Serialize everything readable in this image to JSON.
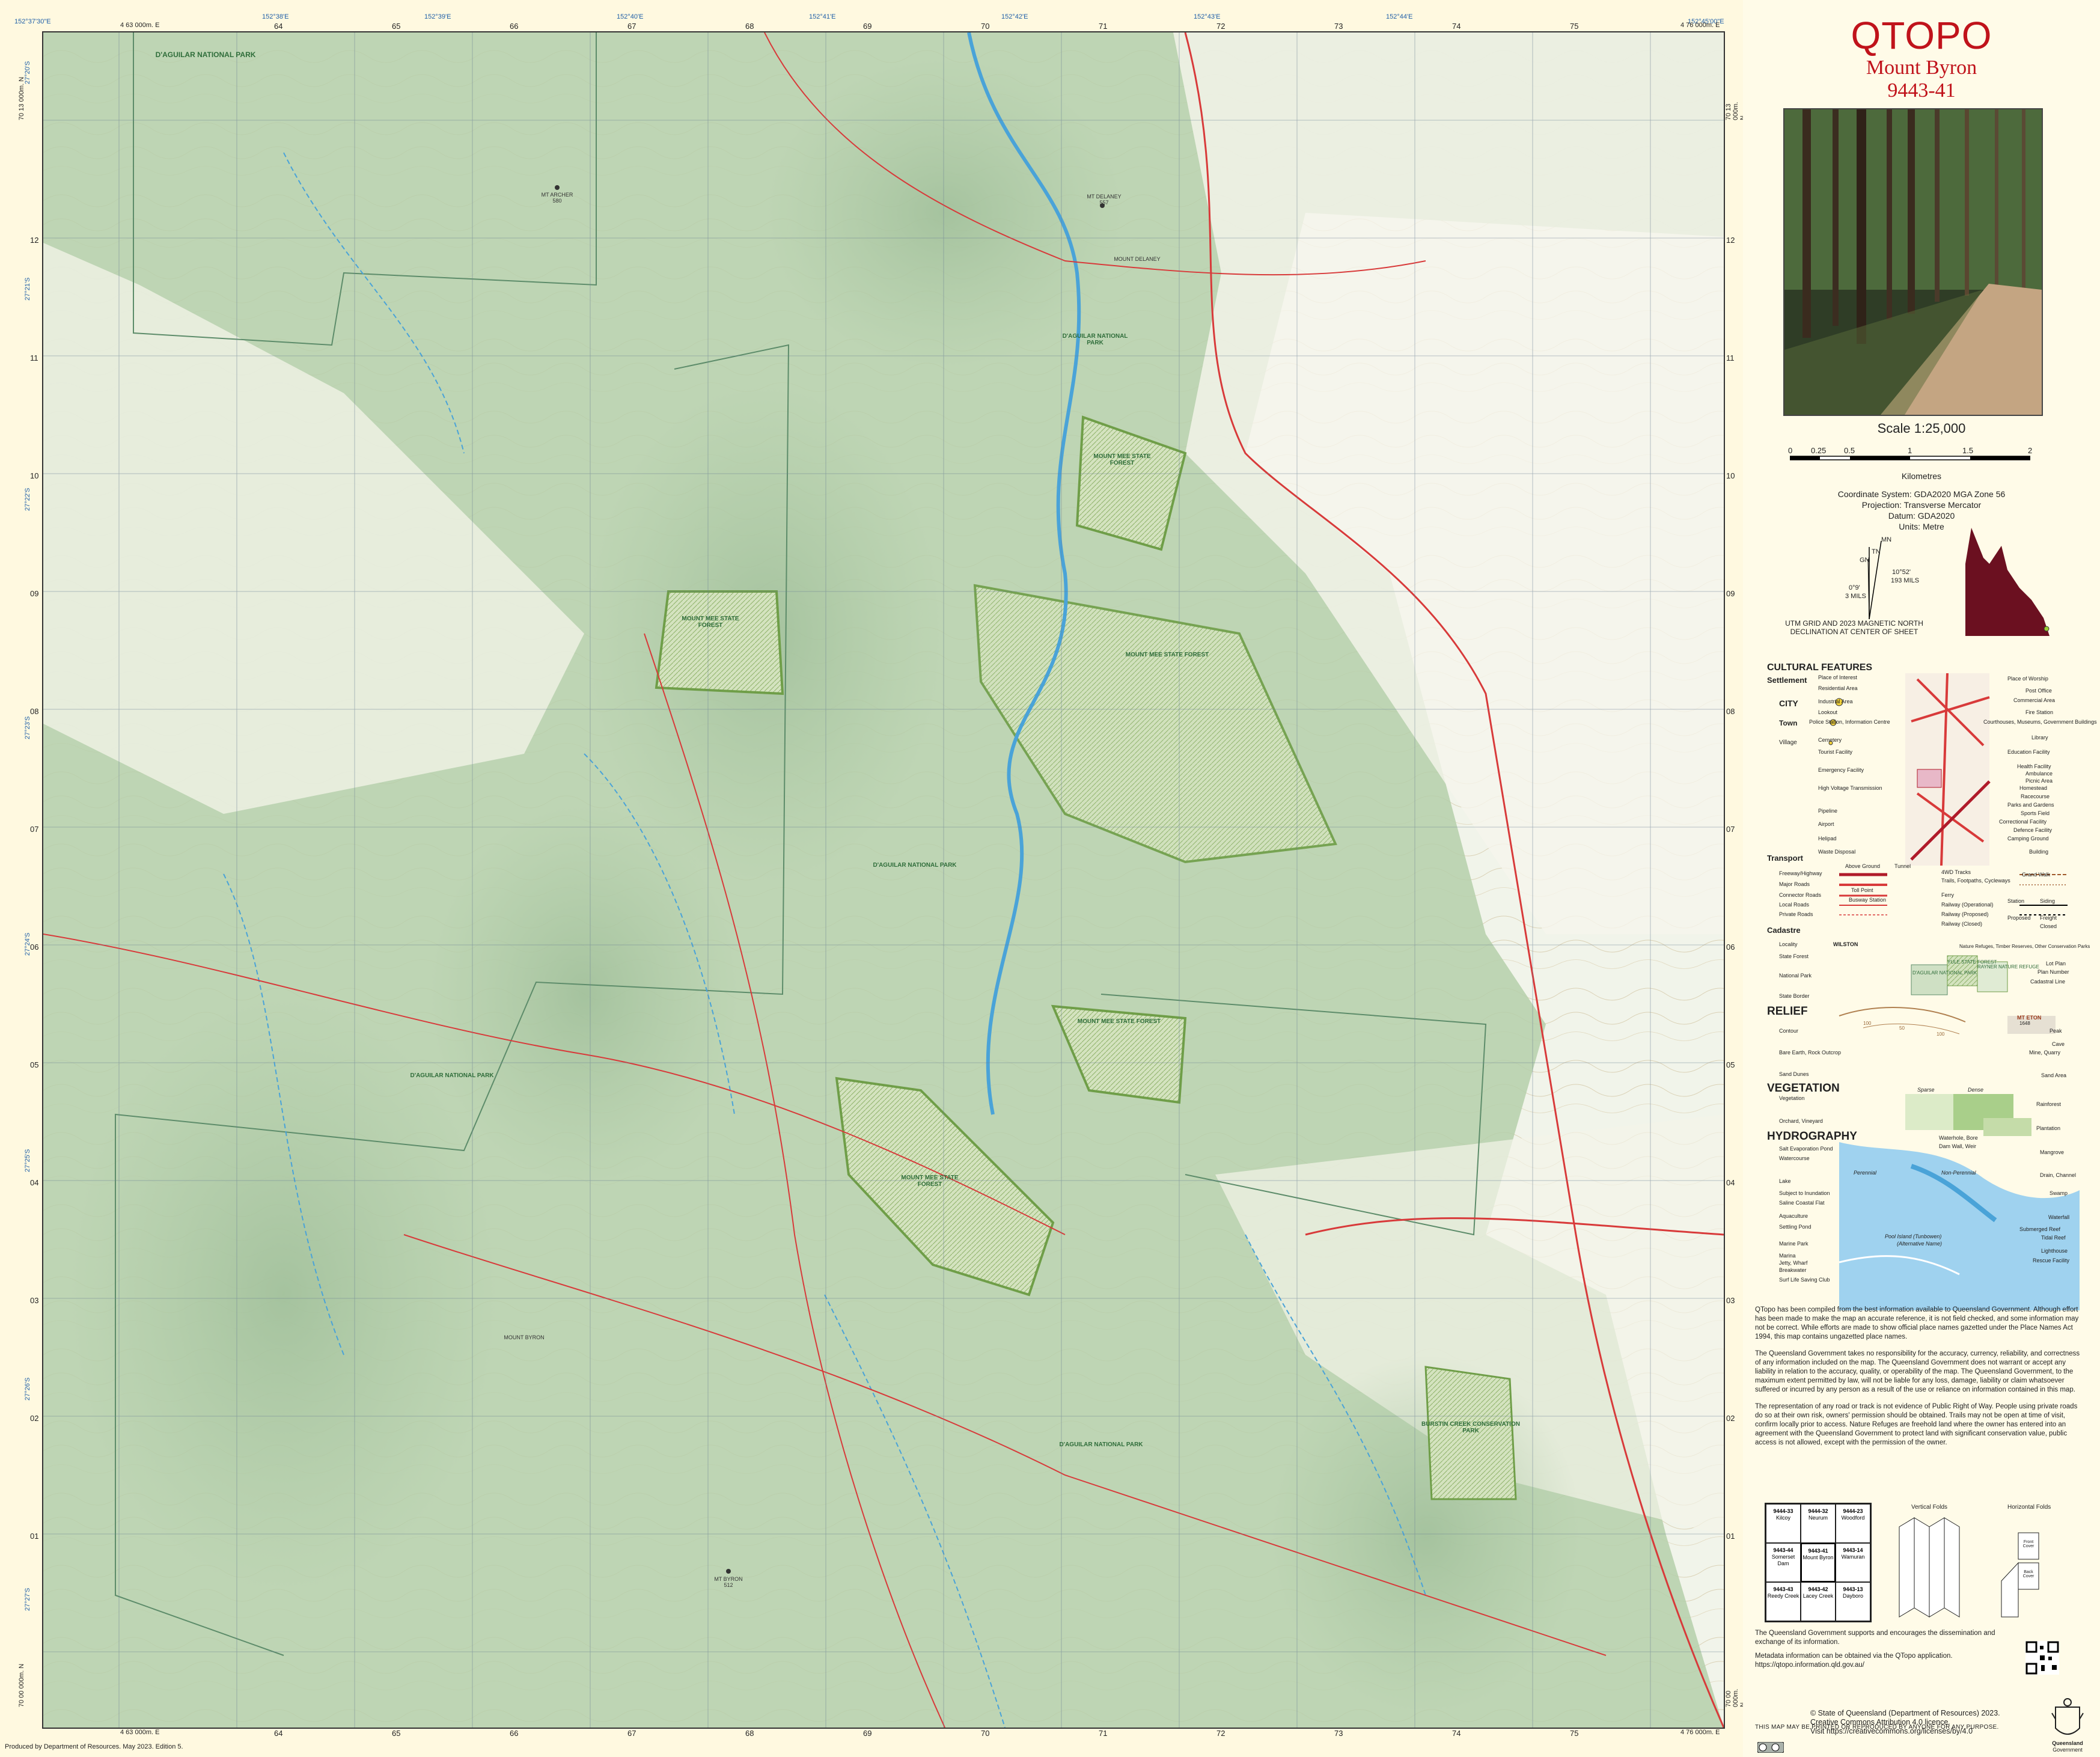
{
  "header": {
    "title": "QTOPO",
    "sheet_name": "Mount Byron",
    "sheet_number": "9443-41"
  },
  "map": {
    "top_left_corner": "152°37'30\"E",
    "top_minutes": [
      "152°38'E",
      "152°39'E",
      "152°40'E",
      "152°41'E",
      "152°42'E",
      "152°43'E",
      "152°44'E",
      "152°45'E"
    ],
    "top_right_corner": "152°45'00\"E",
    "eastings": [
      "64",
      "65",
      "66",
      "67",
      "68",
      "69",
      "70",
      "71",
      "72",
      "73",
      "74",
      "75"
    ],
    "easting_first": "4 63 000m. E",
    "easting_last": "4 76 000m. E",
    "easting_first_bottom": "4 63 000m. E",
    "easting_last_bottom": "4 76 000m. E",
    "northings": [
      "12",
      "11",
      "10",
      "09",
      "08",
      "07",
      "06",
      "05",
      "04",
      "03",
      "02",
      "01"
    ],
    "northing_top": "70 13 000m. N",
    "northing_bottom": "70 00 000m. N",
    "left_lat_labels": [
      "27°20'S",
      "27°21'S",
      "27°22'S",
      "27°23'S",
      "27°24'S",
      "27°25'S",
      "27°26'S",
      "27°27'S"
    ],
    "place_labels": {
      "daguilar_np_top": "D'AGUILAR NATIONAL PARK",
      "mt_archer": "MT ARCHER",
      "mt_delaney_peak": "MT DELANEY",
      "mount_delaney": "MOUNT DELANEY",
      "daguilar_np_1": "D'AGUILAR NATIONAL PARK",
      "mount_mee_sf_1": "MOUNT MEE STATE FOREST",
      "mount_mee_sf_2": "MOUNT MEE STATE FOREST",
      "mount_mee_sf_3": "MOUNT MEE STATE FOREST",
      "daguilar_np_2": "D'AGUILAR NATIONAL PARK",
      "mount_mee_sf_4": "MOUNT MEE STATE FOREST",
      "daguilar_np_3": "D'AGUILAR NATIONAL PARK",
      "mount_mee_sf_5": "MOUNT MEE STATE FOREST",
      "mount_byron": "MOUNT BYRON",
      "daguilar_np_4": "D'AGUILAR NATIONAL PARK",
      "conservation_park": "BURSTIN CREEK CONSERVATION PARK",
      "mt_byron_peak": "MT BYRON",
      "mt_byron_height": "512",
      "mt_archer_height": "580",
      "mt_delaney_height": "557"
    },
    "produced": "Produced by Department of Resources. May 2023. Edition 5."
  },
  "side": {
    "scale": "Scale 1:25,000",
    "scale_ticks": [
      "0",
      "0.25",
      "0.5",
      "1",
      "1.5",
      "2"
    ],
    "scale_unit": "Kilometres",
    "coord_system": "Coordinate System: GDA2020 MGA Zone 56",
    "projection": "Projection: Transverse Mercator",
    "datum": "Datum: GDA2020",
    "units": "Units: Metre",
    "decl_mn": "MN",
    "decl_gn": "GN",
    "decl_tn": "TN",
    "decl_mag": "10°52'",
    "decl_mag_mils": "193 MILS",
    "decl_grid": "0°9'",
    "decl_grid_mils": "3 MILS",
    "decl_note": "UTM GRID AND 2023 MAGNETIC NORTH DECLINATION AT CENTER OF SHEET",
    "colors": {
      "title_red": "#c0131b",
      "qld_maroon": "#6b1020",
      "park_green": "#cfe0c4",
      "forest_green": "#6f9e48",
      "road_red": "#d83a3a",
      "water_blue": "#4aa3d8"
    }
  },
  "legend": {
    "cultural": "CULTURAL FEATURES",
    "settlement": "Settlement",
    "city": "CITY",
    "town": "Town",
    "village": "Village",
    "items_left": [
      "Place of Interest",
      "Residential Area",
      "Industrial Area",
      "Lookout",
      "Police Station, Information Centre",
      "Cemetery",
      "Tourist Facility",
      "Emergency Facility",
      "High Voltage Transmission",
      "Pipeline",
      "Airport",
      "Helipad",
      "Waste Disposal"
    ],
    "items_right": [
      "Place of Worship",
      "Post Office",
      "Commercial Area",
      "Fire Station",
      "Courthouses, Museums, Government Buildings",
      "Library",
      "Education Facility",
      "Health Facility",
      "Ambulance",
      "Picnic Area",
      "Homestead",
      "Racecourse",
      "Parks and Gardens",
      "Sports Field",
      "Correctional Facility",
      "Defence Facility",
      "Camping Ground",
      "Building"
    ],
    "transport": "Transport",
    "transport_items": [
      "Freeway/Highway",
      "Major Roads",
      "Connector Roads",
      "Local Roads",
      "Private Roads"
    ],
    "transport_mid": [
      "Above Ground",
      "Tunnel",
      "Toll Point",
      "Busway Station"
    ],
    "transport_right": [
      "4WD Tracks",
      "Trails, Footpaths, Cycleways",
      "Ferry",
      "Railway (Operational)",
      "Railway (Proposed)",
      "Railway (Closed)",
      "Grand Walk",
      "Station",
      "Siding",
      "Proposed",
      "Freight",
      "Closed"
    ],
    "cadastre": "Cadastre",
    "cadastre_items": [
      "Locality",
      "State Forest",
      "National Park",
      "State Border"
    ],
    "locality_example": "WILSTON",
    "cadastre_boxes": [
      "D'AGUILAR NATIONAL PARK",
      "YULE STATE FOREST",
      "RAYNER NATURE REFUGE"
    ],
    "cadastre_right": [
      "Nature Refuges, Timber Reserves, Other Conservation Parks",
      "Lot Plan",
      "Plan Number",
      "Cadastral Line"
    ],
    "relief": "RELIEF",
    "relief_items": [
      "Contour",
      "Bare Earth, Rock Outcrop",
      "Sand Dunes"
    ],
    "relief_right": [
      "Peak",
      "Cave",
      "Mine, Quarry",
      "Sand Area"
    ],
    "peak_example": "MT ETON",
    "peak_height": "1648",
    "contour_values": [
      "100",
      "50",
      "100"
    ],
    "vegetation": "VEGETATION",
    "vegetation_items": [
      "Vegetation",
      "Orchard, Vineyard"
    ],
    "vegetation_mid": [
      "Sparse",
      "Dense"
    ],
    "vegetation_right": [
      "Rainforest",
      "Plantation"
    ],
    "hydrography": "HYDROGRAPHY",
    "hydro_items": [
      "Salt Evaporation Pond",
      "Watercourse",
      "Lake",
      "Subject to Inundation",
      "Saline Coastal Flat",
      "Aquaculture",
      "Settling Pond",
      "Marine Park",
      "Marina",
      "Jetty, Wharf",
      "Breakwater",
      "Surf Life Saving Club"
    ],
    "hydro_mid": [
      "Waterhole, Bore",
      "Dam Wall, Weir",
      "Perennial",
      "Non-Perennial",
      "Pool Island (Tunbowen)",
      "(Alternative Name)"
    ],
    "hydro_right": [
      "Mangrove",
      "Drain, Channel",
      "Swamp",
      "Waterfall",
      "Submerged Reef",
      "Tidal Reef",
      "Lighthouse",
      "Rescue Facility"
    ]
  },
  "disclaimer": [
    "QTopo has been compiled from the best information available to Queensland Government. Although effort has been made to make the map an accurate reference, it is not field checked, and some information may not be correct. While efforts are made to show official place names gazetted under the Place Names Act 1994, this map contains ungazetted place names.",
    "The Queensland Government takes no responsibility for the accuracy, currency, reliability, and correctness of any information included on the map. The Queensland Government does not warrant or accept any liability in relation to the accuracy, quality, or operability of the map. The Queensland Government, to the maximum extent permitted by law, will not be liable for any loss, damage, liability or claim whatsoever suffered or incurred by any person as a result of the use or reliance on information contained in this map.",
    "The representation of any road or track is not evidence of Public Right of Way. People using private roads do so at their own risk, owners' permission should be obtained. Trails may not be open at time of visit, confirm locally prior to access. Nature Refuges are freehold land where the owner has entered into an agreement with the Queensland Government to protect land with significant conservation value, public access is not allowed, except with the permission of the owner."
  ],
  "adjoining_sheets": [
    {
      "num": "9444-33",
      "name": "Kilcoy"
    },
    {
      "num": "9444-32",
      "name": "Neurum"
    },
    {
      "num": "9444-23",
      "name": "Woodford"
    },
    {
      "num": "9443-44",
      "name": "Somerset Dam"
    },
    {
      "num": "9443-41",
      "name": "Mount Byron"
    },
    {
      "num": "9443-14",
      "name": "Wamuran"
    },
    {
      "num": "9443-43",
      "name": "Reedy Creek"
    },
    {
      "num": "9443-42",
      "name": "Lacey Creek"
    },
    {
      "num": "9443-13",
      "name": "Dayboro"
    }
  ],
  "folds": {
    "vertical": "Vertical Folds",
    "horizontal": "Horizontal Folds",
    "front_cover": "Front Cover",
    "back_cover": "Back Cover"
  },
  "support": [
    "The Queensland Government supports and encourages the dissemination and exchange of its information.",
    "Metadata information can be obtained via the QTopo application. https://qtopo.information.qld.gov.au/"
  ],
  "print_note": "THIS MAP MAY BE PRINTED OR REPRODUCED BY ANYONE FOR ANY PURPOSE.",
  "copyright": [
    "© State of Queensland (Department of Resources) 2023.",
    "Creative Commons Attribution 4.0 licence.",
    "Visit https://creativecommons.org/licenses/by/4.0"
  ],
  "crest": [
    "Queensland",
    "Government"
  ]
}
